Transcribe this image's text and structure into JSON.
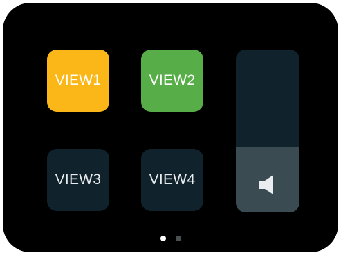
{
  "views": [
    {
      "label": "VIEW1",
      "color": "#FBB717",
      "state": "active"
    },
    {
      "label": "VIEW2",
      "color": "#57AE49",
      "state": "active"
    },
    {
      "label": "VIEW3",
      "color": "#10222B",
      "state": "inactive"
    },
    {
      "label": "VIEW4",
      "color": "#10222B",
      "state": "inactive"
    }
  ],
  "volume": {
    "icon": "speaker-icon",
    "level": 0.4,
    "track_color": "#10222B",
    "fill_color": "#3B4B52"
  },
  "pagination": {
    "pages": 2,
    "current": 1
  }
}
